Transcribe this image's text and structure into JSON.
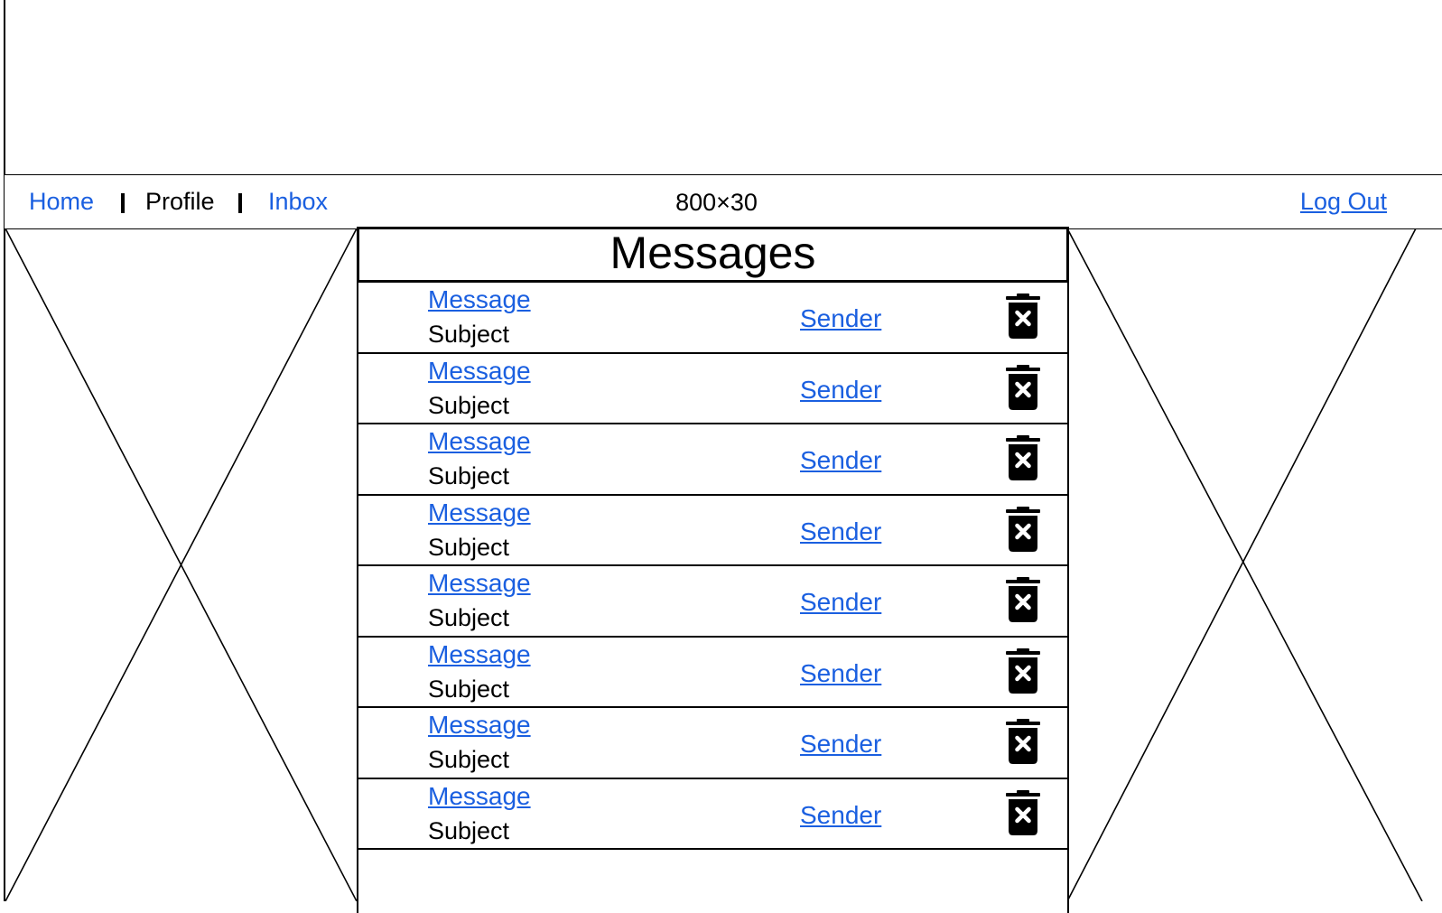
{
  "header": {
    "banner_text": ""
  },
  "nav": {
    "home_label": "Home",
    "profile_label": "Profile",
    "inbox_label": "Inbox",
    "center_text": "800×30",
    "logout_label": "Log Out"
  },
  "messages": {
    "title": "Messages",
    "rows": [
      {
        "message_label": "Message",
        "subject": "Subject",
        "sender_label": "Sender",
        "delete_icon": "trash-x-icon"
      },
      {
        "message_label": "Message",
        "subject": "Subject",
        "sender_label": "Sender",
        "delete_icon": "trash-x-icon"
      },
      {
        "message_label": "Message",
        "subject": "Subject",
        "sender_label": "Sender",
        "delete_icon": "trash-x-icon"
      },
      {
        "message_label": "Message",
        "subject": "Subject",
        "sender_label": "Sender",
        "delete_icon": "trash-x-icon"
      },
      {
        "message_label": "Message",
        "subject": "Subject",
        "sender_label": "Sender",
        "delete_icon": "trash-x-icon"
      },
      {
        "message_label": "Message",
        "subject": "Subject",
        "sender_label": "Sender",
        "delete_icon": "trash-x-icon"
      },
      {
        "message_label": "Message",
        "subject": "Subject",
        "sender_label": "Sender",
        "delete_icon": "trash-x-icon"
      },
      {
        "message_label": "Message",
        "subject": "Subject",
        "sender_label": "Sender",
        "delete_icon": "trash-x-icon"
      }
    ]
  },
  "colors": {
    "link": "#1a5fe0",
    "border": "#000000",
    "background": "#ffffff"
  }
}
